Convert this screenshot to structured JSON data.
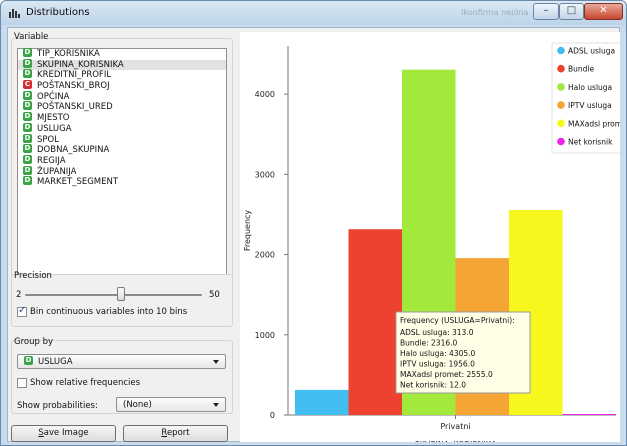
{
  "window": {
    "title": "Distributions",
    "ghost_title": "Ikonfirma nejdna"
  },
  "titlebar_buttons": {
    "minimize": "–",
    "maximize": "□",
    "close": "✕"
  },
  "variable": {
    "label": "Variable",
    "items": [
      {
        "label": "TIP_KORISNIKA",
        "type": "D"
      },
      {
        "label": "SKUPINA_KORISNIKA",
        "type": "D",
        "selected": true
      },
      {
        "label": "KREDITNI_PROFIL",
        "type": "D"
      },
      {
        "label": "POŠTANSKI_BROJ",
        "type": "C"
      },
      {
        "label": "OPĆINA",
        "type": "D"
      },
      {
        "label": "POŠTANSKI_URED",
        "type": "D"
      },
      {
        "label": "MJESTO",
        "type": "D"
      },
      {
        "label": "USLUGA",
        "type": "D"
      },
      {
        "label": "SPOL",
        "type": "D"
      },
      {
        "label": "DOBNA_SKUPINA",
        "type": "D"
      },
      {
        "label": "REGIJA",
        "type": "D"
      },
      {
        "label": "ŽUPANIJA",
        "type": "D"
      },
      {
        "label": "MARKET_SEGMENT",
        "type": "D"
      }
    ]
  },
  "precision": {
    "label": "Precision",
    "min": "2",
    "max": "50",
    "value": 10,
    "bin_label": "Bin continuous variables into 10 bins",
    "bin_checked": true
  },
  "group_by": {
    "label": "Group by",
    "selected": "USLUGA",
    "selected_badge": "D",
    "relative_label": "Show relative frequencies",
    "relative_checked": false,
    "probabilities_label": "Show probabilities:",
    "probabilities_value": "(None)"
  },
  "buttons": {
    "save_image": {
      "prefix": "",
      "mnemonic": "S",
      "rest": "ave Image"
    },
    "report": {
      "prefix": "",
      "mnemonic": "R",
      "rest": "eport"
    }
  },
  "chart_data": {
    "type": "bar",
    "title": "",
    "xlabel": "SKUPINA_KORISNIKA",
    "ylabel": "Frequency",
    "categories": [
      "Privatni"
    ],
    "ylim": [
      0,
      4600
    ],
    "yticks": [
      0,
      1000,
      2000,
      3000,
      4000
    ],
    "legend_position": "top-right",
    "series": [
      {
        "name": "ADSL usluga",
        "values": [
          313
        ],
        "color": "#42bdf0"
      },
      {
        "name": "Bundle",
        "values": [
          2316
        ],
        "color": "#ee4231"
      },
      {
        "name": "Halo usluga",
        "values": [
          4305
        ],
        "color": "#a2e93c"
      },
      {
        "name": "IPTV usluga",
        "values": [
          1956
        ],
        "color": "#f5a533"
      },
      {
        "name": "MAXadsl promet",
        "values": [
          2555
        ],
        "color": "#f7f71d"
      },
      {
        "name": "Net korisnik",
        "values": [
          12
        ],
        "color": "#ec21ea"
      }
    ],
    "tooltip": {
      "title": "Frequency (USLUGA=Privatni):",
      "lines": [
        "ADSL usluga: 313.0",
        "Bundle: 2316.0",
        "Halo usluga: 4305.0",
        "IPTV usluga: 1956.0",
        "MAXadsl promet: 2555.0",
        "Net korisnik: 12.0"
      ]
    }
  }
}
